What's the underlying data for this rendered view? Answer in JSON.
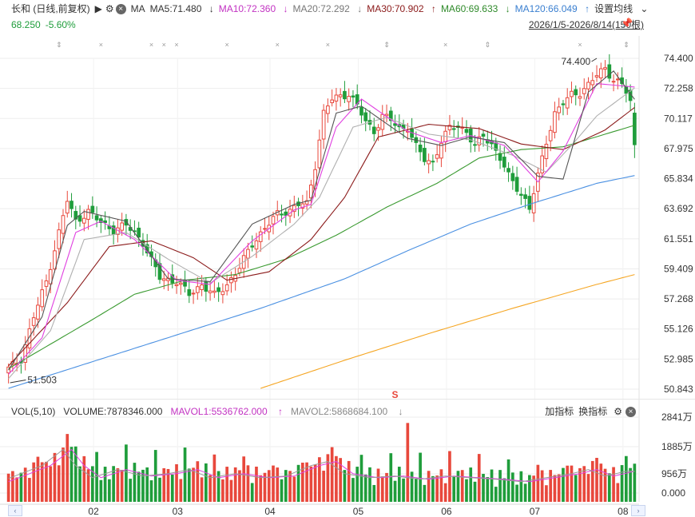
{
  "legend": {
    "name": "长和 (日线,前复权)",
    "ma_label": "MA",
    "ma5": "MA5:71.480",
    "ma10": "MA10:72.360",
    "ma20": "MA20:72.292",
    "ma30": "MA30:70.902",
    "ma60": "MA60:69.633",
    "ma120": "MA120:66.049",
    "settings": "设置均线",
    "price": "68.250",
    "change": "-5.60%",
    "range": "2026/1/5-2026/8/14(150根)"
  },
  "volume_legend": {
    "vol": "VOL(5,10)",
    "volume": "VOLUME:7878346.000",
    "mavol1": "MAVOL1:5536762.000",
    "mavol2": "MAVOL2:5868684.100",
    "add_indicator": "加指标",
    "switch_indicator": "换指标"
  },
  "colors": {
    "up": "#e8483c",
    "down": "#1f9d3b",
    "ma5": "#555555",
    "ma10": "#e040e0",
    "ma20": "#b0b0b0",
    "ma30": "#8b1a1a",
    "ma60": "#3a9a30",
    "ma120": "#4a90e2",
    "ma250": "#f5a623"
  },
  "chart_data": {
    "type": "candlestick",
    "y_ticks": [
      "74.400",
      "72.258",
      "70.117",
      "67.975",
      "65.834",
      "63.692",
      "61.551",
      "59.409",
      "57.268",
      "55.126",
      "52.985",
      "50.843"
    ],
    "ylim": [
      50.843,
      74.4
    ],
    "x_ticks": [
      "02",
      "03",
      "04",
      "05",
      "06",
      "07",
      "08"
    ],
    "annotations": {
      "high": "74.400",
      "low": "51.503"
    },
    "volume_y_ticks": [
      "2841万",
      "1885万",
      "956万",
      "0.000"
    ],
    "ma_anchors": {
      "ma5": [
        [
          0,
          52.2
        ],
        [
          8,
          56.0
        ],
        [
          14,
          62.5
        ],
        [
          18,
          63.5
        ],
        [
          28,
          62.8
        ],
        [
          38,
          58.7
        ],
        [
          48,
          58.5
        ],
        [
          58,
          62.6
        ],
        [
          68,
          64.0
        ],
        [
          72,
          64.3
        ],
        [
          78,
          70.5
        ],
        [
          84,
          71.0
        ],
        [
          95,
          68.7
        ],
        [
          103,
          68.2
        ],
        [
          110,
          68.8
        ],
        [
          118,
          68.4
        ],
        [
          126,
          66.0
        ],
        [
          132,
          65.8
        ],
        [
          138,
          72.0
        ],
        [
          144,
          73.5
        ],
        [
          149,
          71.48
        ]
      ],
      "ma10": [
        [
          0,
          51.9
        ],
        [
          8,
          54.5
        ],
        [
          16,
          62.0
        ],
        [
          22,
          62.8
        ],
        [
          30,
          61.5
        ],
        [
          40,
          58.6
        ],
        [
          48,
          58.3
        ],
        [
          58,
          61.4
        ],
        [
          68,
          63.6
        ],
        [
          72,
          64.0
        ],
        [
          78,
          69.5
        ],
        [
          84,
          71.5
        ],
        [
          95,
          69.2
        ],
        [
          103,
          68.4
        ],
        [
          110,
          68.9
        ],
        [
          118,
          68.2
        ],
        [
          126,
          65.6
        ],
        [
          132,
          67.8
        ],
        [
          140,
          72.6
        ],
        [
          149,
          72.36
        ]
      ],
      "ma20": [
        [
          0,
          51.6
        ],
        [
          10,
          55.0
        ],
        [
          18,
          61.5
        ],
        [
          28,
          62.0
        ],
        [
          38,
          60.1
        ],
        [
          48,
          58.4
        ],
        [
          58,
          60.3
        ],
        [
          68,
          62.6
        ],
        [
          74,
          64.5
        ],
        [
          82,
          69.5
        ],
        [
          90,
          70.2
        ],
        [
          100,
          69.0
        ],
        [
          110,
          68.6
        ],
        [
          120,
          67.5
        ],
        [
          128,
          66.3
        ],
        [
          134,
          68.2
        ],
        [
          140,
          70.3
        ],
        [
          149,
          72.29
        ]
      ],
      "ma30": [
        [
          0,
          52.5
        ],
        [
          14,
          57.0
        ],
        [
          24,
          61.0
        ],
        [
          34,
          61.4
        ],
        [
          44,
          60.2
        ],
        [
          52,
          58.6
        ],
        [
          62,
          59.2
        ],
        [
          72,
          61.5
        ],
        [
          80,
          64.5
        ],
        [
          88,
          68.8
        ],
        [
          100,
          69.7
        ],
        [
          112,
          69.4
        ],
        [
          122,
          68.3
        ],
        [
          132,
          67.9
        ],
        [
          142,
          69.3
        ],
        [
          149,
          70.9
        ]
      ],
      "ma60": [
        [
          0,
          52.3
        ],
        [
          20,
          55.8
        ],
        [
          30,
          57.6
        ],
        [
          42,
          58.6
        ],
        [
          54,
          59.0
        ],
        [
          66,
          60.1
        ],
        [
          78,
          61.8
        ],
        [
          90,
          63.8
        ],
        [
          102,
          65.5
        ],
        [
          112,
          67.3
        ],
        [
          122,
          67.9
        ],
        [
          132,
          68.1
        ],
        [
          142,
          69.0
        ],
        [
          149,
          69.63
        ]
      ],
      "ma120": [
        [
          0,
          50.9
        ],
        [
          20,
          52.8
        ],
        [
          40,
          54.7
        ],
        [
          60,
          56.6
        ],
        [
          80,
          58.7
        ],
        [
          95,
          60.7
        ],
        [
          110,
          62.6
        ],
        [
          125,
          64.1
        ],
        [
          140,
          65.5
        ],
        [
          149,
          66.05
        ]
      ],
      "ma250": [
        [
          60,
          50.9
        ],
        [
          80,
          52.9
        ],
        [
          100,
          54.8
        ],
        [
          120,
          56.6
        ],
        [
          140,
          58.3
        ],
        [
          149,
          59.0
        ]
      ]
    },
    "close_anchors": [
      [
        0,
        52.3
      ],
      [
        3,
        53.0
      ],
      [
        6,
        56.0
      ],
      [
        9,
        58.5
      ],
      [
        12,
        62.0
      ],
      [
        14,
        64.3
      ],
      [
        16,
        62.8
      ],
      [
        19,
        63.5
      ],
      [
        22,
        62.7
      ],
      [
        25,
        62.2
      ],
      [
        28,
        62.5
      ],
      [
        30,
        62.0
      ],
      [
        32,
        61.3
      ],
      [
        34,
        60.0
      ],
      [
        36,
        58.8
      ],
      [
        40,
        58.5
      ],
      [
        43,
        57.6
      ],
      [
        46,
        58.3
      ],
      [
        49,
        57.5
      ],
      [
        52,
        58.3
      ],
      [
        55,
        59.5
      ],
      [
        58,
        61.2
      ],
      [
        61,
        62.3
      ],
      [
        64,
        63.3
      ],
      [
        67,
        63.6
      ],
      [
        69,
        64.0
      ],
      [
        71,
        64.0
      ],
      [
        73,
        66.8
      ],
      [
        75,
        70.5
      ],
      [
        77,
        71.5
      ],
      [
        79,
        71.7
      ],
      [
        81,
        71.9
      ],
      [
        83,
        71.0
      ],
      [
        85,
        69.9
      ],
      [
        87,
        69.2
      ],
      [
        89,
        70.3
      ],
      [
        91,
        70.0
      ],
      [
        93,
        69.4
      ],
      [
        95,
        69.5
      ],
      [
        97,
        68.1
      ],
      [
        99,
        67.2
      ],
      [
        101,
        67.0
      ],
      [
        103,
        68.5
      ],
      [
        105,
        69.4
      ],
      [
        107,
        69.6
      ],
      [
        109,
        69.2
      ],
      [
        111,
        68.1
      ],
      [
        113,
        68.9
      ],
      [
        115,
        68.3
      ],
      [
        117,
        67.3
      ],
      [
        119,
        66.0
      ],
      [
        121,
        65.2
      ],
      [
        123,
        64.3
      ],
      [
        124,
        63.7
      ],
      [
        126,
        66.0
      ],
      [
        128,
        68.5
      ],
      [
        130,
        70.5
      ],
      [
        132,
        71.2
      ],
      [
        134,
        71.8
      ],
      [
        136,
        72.0
      ],
      [
        138,
        72.5
      ],
      [
        140,
        73.2
      ],
      [
        142,
        73.7
      ],
      [
        144,
        72.9
      ],
      [
        146,
        72.5
      ],
      [
        147,
        72.0
      ],
      [
        148,
        71.3
      ],
      [
        149,
        68.25
      ]
    ],
    "volume_anchors": [
      [
        0,
        0.15
      ],
      [
        5,
        0.25
      ],
      [
        10,
        0.35
      ],
      [
        15,
        0.55
      ],
      [
        18,
        0.35
      ],
      [
        22,
        0.2
      ],
      [
        28,
        0.3
      ],
      [
        34,
        0.22
      ],
      [
        40,
        0.25
      ],
      [
        45,
        0.3
      ],
      [
        50,
        0.2
      ],
      [
        56,
        0.25
      ],
      [
        62,
        0.2
      ],
      [
        68,
        0.22
      ],
      [
        74,
        0.35
      ],
      [
        78,
        0.4
      ],
      [
        82,
        0.25
      ],
      [
        88,
        0.2
      ],
      [
        94,
        0.22
      ],
      [
        100,
        0.18
      ],
      [
        106,
        0.22
      ],
      [
        112,
        0.2
      ],
      [
        118,
        0.18
      ],
      [
        124,
        0.15
      ],
      [
        130,
        0.2
      ],
      [
        136,
        0.25
      ],
      [
        140,
        0.3
      ],
      [
        144,
        0.22
      ],
      [
        149,
        0.28
      ]
    ]
  }
}
